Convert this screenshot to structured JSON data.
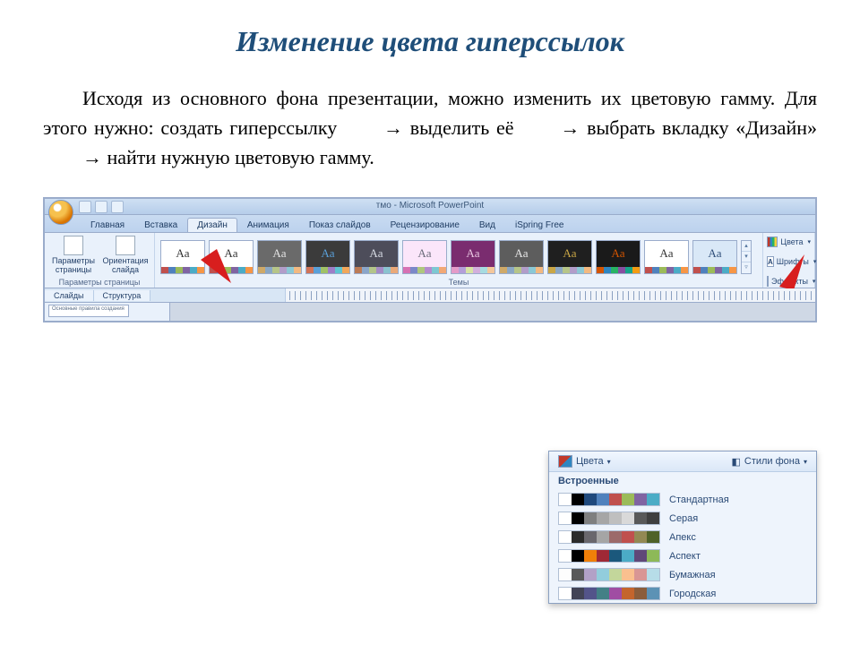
{
  "title": "Изменение цвета гиперссылок",
  "paragraph_parts": {
    "before1": "Исходя из основного фона презентации, можно изменить их цветовую гамму. Для этого нужно: создать гиперссылку ",
    "mid1": " выделить её ",
    "mid2": " выбрать вкладку «Дизайн» ",
    "after": " найти нужную цветовую гамму."
  },
  "arrow_glyph": "→",
  "ribbon": {
    "doc_title": "тмо - Microsoft PowerPoint",
    "tabs": [
      "Главная",
      "Вставка",
      "Дизайн",
      "Анимация",
      "Показ слайдов",
      "Рецензирование",
      "Вид",
      "iSpring Free"
    ],
    "active_tab_index": 2,
    "page_setup": {
      "btn1": "Параметры страницы",
      "btn2": "Ориентация слайда",
      "group_label": "Параметры страницы"
    },
    "themes_label": "Темы",
    "themes": [
      {
        "bg": "#ffffff",
        "fg": "#333333",
        "bar": [
          "#c0504d",
          "#4f81bd",
          "#9bbb59",
          "#8064a2",
          "#4bacc6",
          "#f79646"
        ]
      },
      {
        "bg": "#ffffff",
        "fg": "#333333",
        "bar": [
          "#c0504d",
          "#4f81bd",
          "#9bbb59",
          "#8064a2",
          "#4bacc6",
          "#f79646"
        ]
      },
      {
        "bg": "#6a6a6a",
        "fg": "#e4e4e4",
        "bar": [
          "#cfa968",
          "#8aa7c4",
          "#b6c588",
          "#b29dc9",
          "#8ac8d5",
          "#f2b981"
        ]
      },
      {
        "bg": "#3b3b3b",
        "fg": "#5aa0d8",
        "bar": [
          "#d17357",
          "#5aa0d8",
          "#a0c266",
          "#9e7ec7",
          "#5fc5d1",
          "#f1a75a"
        ]
      },
      {
        "bg": "#4d4d5a",
        "fg": "#d7dbe4",
        "bar": [
          "#bb7b57",
          "#8aa5c9",
          "#b3c58a",
          "#a58cc6",
          "#8bc3cf",
          "#eaa979"
        ]
      },
      {
        "bg": "#fbe6fa",
        "fg": "#6b6b7a",
        "bar": [
          "#d671b3",
          "#7b88c8",
          "#aec77d",
          "#b48bce",
          "#7dc8d2",
          "#f2a876"
        ]
      },
      {
        "bg": "#7a2c6f",
        "fg": "#e9c6e1",
        "bar": [
          "#e49bc8",
          "#b49ed8",
          "#d7e3a5",
          "#d2afdc",
          "#a6dbe0",
          "#f4c79b"
        ]
      },
      {
        "bg": "#5d5d5d",
        "fg": "#e8e8e8",
        "bar": [
          "#cfa968",
          "#8aa7c4",
          "#b6c588",
          "#b29dc9",
          "#8ac8d5",
          "#f2b981"
        ]
      },
      {
        "bg": "#1f1f1f",
        "fg": "#c9a646",
        "bar": [
          "#c9a646",
          "#8aa7c4",
          "#b6c588",
          "#b29dc9",
          "#8ac8d5",
          "#f2b981"
        ]
      },
      {
        "bg": "#1a1a1a",
        "fg": "#d35400",
        "bar": [
          "#d35400",
          "#2e86c1",
          "#28b463",
          "#884ea0",
          "#17a589",
          "#f39c12"
        ]
      },
      {
        "bg": "#ffffff",
        "fg": "#333333",
        "bar": [
          "#c0504d",
          "#4f81bd",
          "#9bbb59",
          "#8064a2",
          "#4bacc6",
          "#f79646"
        ]
      },
      {
        "bg": "#d9e8f7",
        "fg": "#2f4f7a",
        "bar": [
          "#c0504d",
          "#4f81bd",
          "#9bbb59",
          "#8064a2",
          "#4bacc6",
          "#f79646"
        ]
      }
    ],
    "variants": {
      "colors": "Цвета",
      "fonts": "Шрифты",
      "effects": "Эффекты"
    },
    "left_tabs": {
      "slides": "Слайды",
      "outline": "Структура"
    },
    "mini_slide_text": "Основные правила создания"
  },
  "colors_panel": {
    "colors_btn": "Цвета",
    "bg_styles_btn": "Стили фона",
    "section": "Встроенные",
    "schemes": [
      {
        "name": "Стандартная",
        "sw": [
          "#ffffff",
          "#000000",
          "#1f497d",
          "#4f81bd",
          "#c0504d",
          "#9bbb59",
          "#8064a2",
          "#4bacc6"
        ]
      },
      {
        "name": "Серая",
        "sw": [
          "#ffffff",
          "#000000",
          "#7f7f7f",
          "#a6a6a6",
          "#bfbfbf",
          "#d9d9d9",
          "#595959",
          "#3f3f3f"
        ]
      },
      {
        "name": "Апекс",
        "sw": [
          "#ffffff",
          "#2b2b2b",
          "#69676d",
          "#a5a5a5",
          "#9c6a6a",
          "#c0504d",
          "#938953",
          "#4f6228"
        ]
      },
      {
        "name": "Аспект",
        "sw": [
          "#ffffff",
          "#000000",
          "#f07f09",
          "#9f2936",
          "#1b587c",
          "#4bacc6",
          "#604878",
          "#8db958"
        ]
      },
      {
        "name": "Бумажная",
        "sw": [
          "#fdfdfd",
          "#595959",
          "#b2a1c7",
          "#92cddc",
          "#c3d69b",
          "#fac08f",
          "#d99694",
          "#b7dde8"
        ]
      },
      {
        "name": "Городская",
        "sw": [
          "#ffffff",
          "#424456",
          "#53548a",
          "#438086",
          "#a04da3",
          "#c4652d",
          "#8b5d3b",
          "#5c92b5"
        ]
      }
    ]
  }
}
